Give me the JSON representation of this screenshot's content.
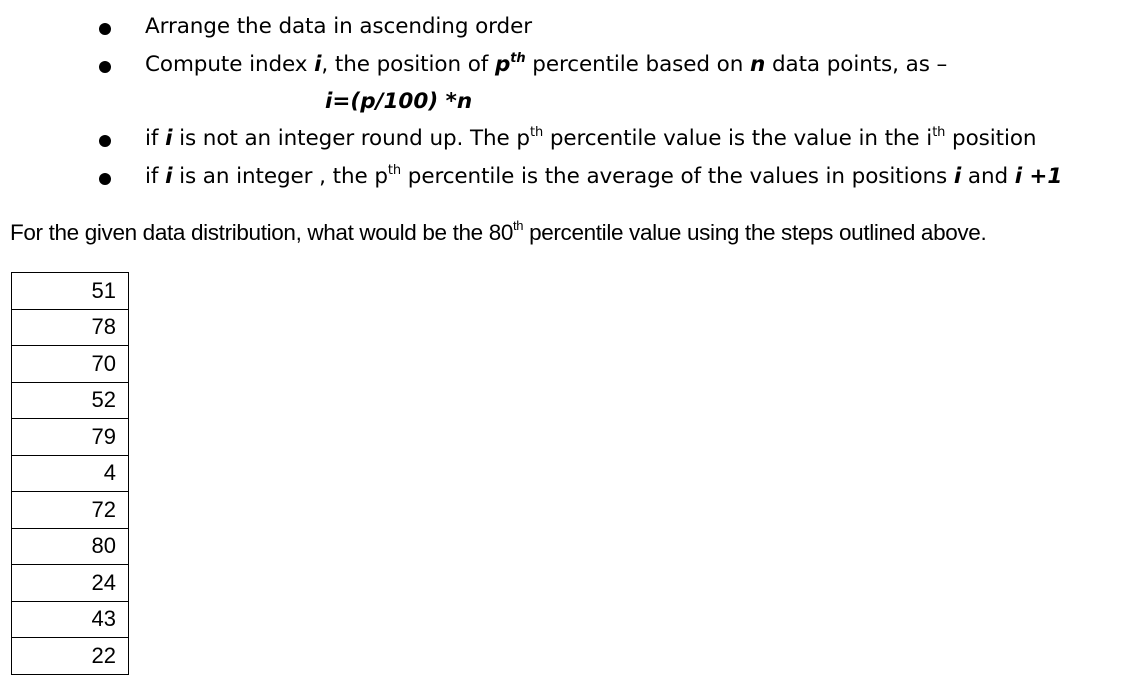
{
  "steps": [
    {
      "text": "Arrange the data in ascending order"
    },
    {
      "prefix": "Compute index ",
      "var_i": "i",
      "mid1": ",  the position of ",
      "var_p": "p",
      "sup_th": "th",
      "mid2": " percentile  based on ",
      "var_n": "n",
      "suffix": " data points, as –",
      "formula": "i=(p/100) *n"
    },
    {
      "prefix": "if ",
      "var_i": "i",
      "mid1": " is not an integer round up. The p",
      "sup_th": "th",
      "mid2": " percentile value is the value in the i",
      "sup_th2": "th",
      "suffix": " position"
    },
    {
      "prefix": "if ",
      "var_i": "i",
      "mid1": " is an integer , the p",
      "sup_th": "th",
      "mid2": " percentile is the average of the values  in positions ",
      "var_i2": "i",
      "and": " and ",
      "var_i3": "i +1"
    }
  ],
  "question": {
    "prefix": "For the given data distribution, what would be the 80",
    "sup": "th",
    "suffix": " percentile value using the steps outlined above."
  },
  "data_values": [
    "51",
    "78",
    "70",
    "52",
    "79",
    "4",
    "72",
    "80",
    "24",
    "43",
    "22"
  ]
}
